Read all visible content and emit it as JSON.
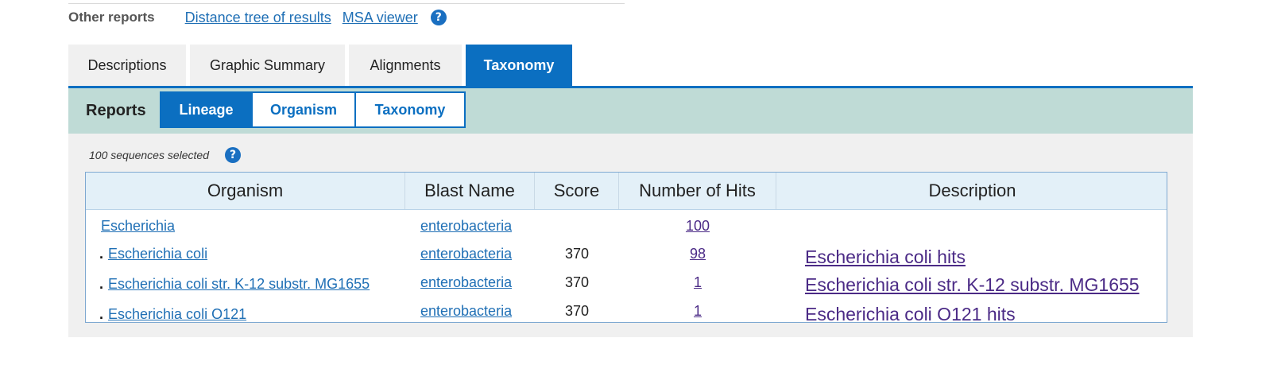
{
  "other_reports": {
    "label": "Other reports",
    "links": [
      "Distance tree of results",
      "MSA viewer"
    ],
    "help": "?"
  },
  "tabs": [
    {
      "label": "Descriptions",
      "active": false
    },
    {
      "label": "Graphic Summary",
      "active": false
    },
    {
      "label": "Alignments",
      "active": false
    },
    {
      "label": "Taxonomy",
      "active": true
    }
  ],
  "reports": {
    "label": "Reports",
    "buttons": [
      {
        "label": "Lineage",
        "active": true
      },
      {
        "label": "Organism",
        "active": false
      },
      {
        "label": "Taxonomy",
        "active": false
      }
    ]
  },
  "selection": {
    "text": "100 sequences selected",
    "help": "?"
  },
  "table": {
    "headers": [
      "Organism",
      "Blast Name",
      "Score",
      "Number of Hits",
      "Description"
    ],
    "rows": [
      {
        "bullet": "",
        "organism": "Escherichia",
        "blast_name": "enterobacteria",
        "score": "",
        "hits": "100",
        "description": ""
      },
      {
        "bullet": ".",
        "organism": "Escherichia coli",
        "blast_name": "enterobacteria",
        "score": "370",
        "hits": "98",
        "description": "Escherichia coli hits"
      },
      {
        "bullet": ".",
        "organism": "Escherichia coli str. K-12 substr. MG1655",
        "blast_name": "enterobacteria",
        "score": "370",
        "hits": "1",
        "description": "Escherichia coli str. K-12 substr. MG1655"
      },
      {
        "bullet": ".",
        "organism": "Escherichia coli O121",
        "blast_name": "enterobacteria",
        "score": "370",
        "hits": "1",
        "description": "Escherichia coli O121 hits"
      }
    ]
  },
  "colors": {
    "accent": "#0b6fc1",
    "reports_bar": "#bfdbd6",
    "visited_link": "#4b2a86"
  }
}
